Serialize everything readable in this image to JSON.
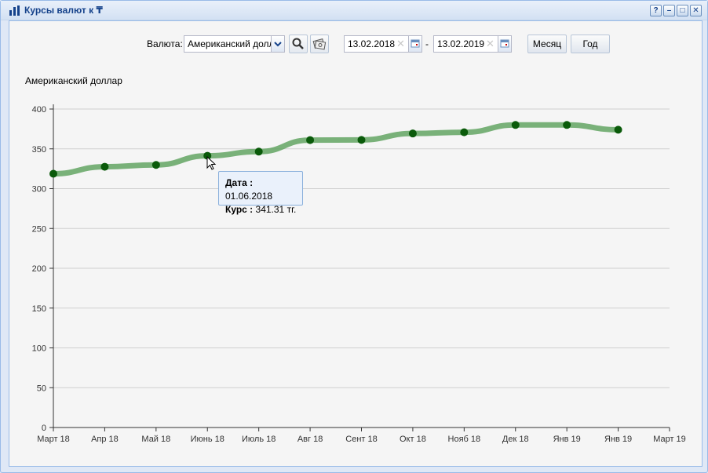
{
  "window": {
    "title": "Курсы валют к ₸",
    "tools": [
      "?",
      "–",
      "□",
      "✕"
    ]
  },
  "toolbar": {
    "currency_label": "Валюта:",
    "currency_value": "Американский доллар",
    "date_from": "13.02.2018",
    "date_separator": "-",
    "date_to": "13.02.2019",
    "month_button": "Месяц",
    "year_button": "Год"
  },
  "tooltip": {
    "date_label": "Дата :",
    "date_value": "01.06.2018",
    "rate_label": "Курс :",
    "rate_value": "341.31 тг."
  },
  "chart_data": {
    "type": "line",
    "title": "Американский доллар",
    "categories": [
      "Март 18",
      "Апр 18",
      "Май 18",
      "Июнь 18",
      "Июль 18",
      "Авг 18",
      "Сент 18",
      "Окт 18",
      "Нояб 18",
      "Дек 18",
      "Янв 19",
      "Янв 19",
      "Март 19"
    ],
    "y_ticks": [
      0,
      50,
      100,
      150,
      200,
      250,
      300,
      350,
      400
    ],
    "ylim": [
      0,
      400
    ],
    "grid": true,
    "series": [
      {
        "color": "#008000",
        "x_index": [
          0,
          1,
          2,
          3,
          4,
          5,
          6,
          7,
          8,
          9,
          10,
          11
        ],
        "values": [
          318.7,
          327.5,
          329.8,
          341.31,
          346.5,
          361.0,
          361.2,
          369.3,
          370.8,
          380.0,
          380.0,
          374.0
        ]
      }
    ]
  }
}
